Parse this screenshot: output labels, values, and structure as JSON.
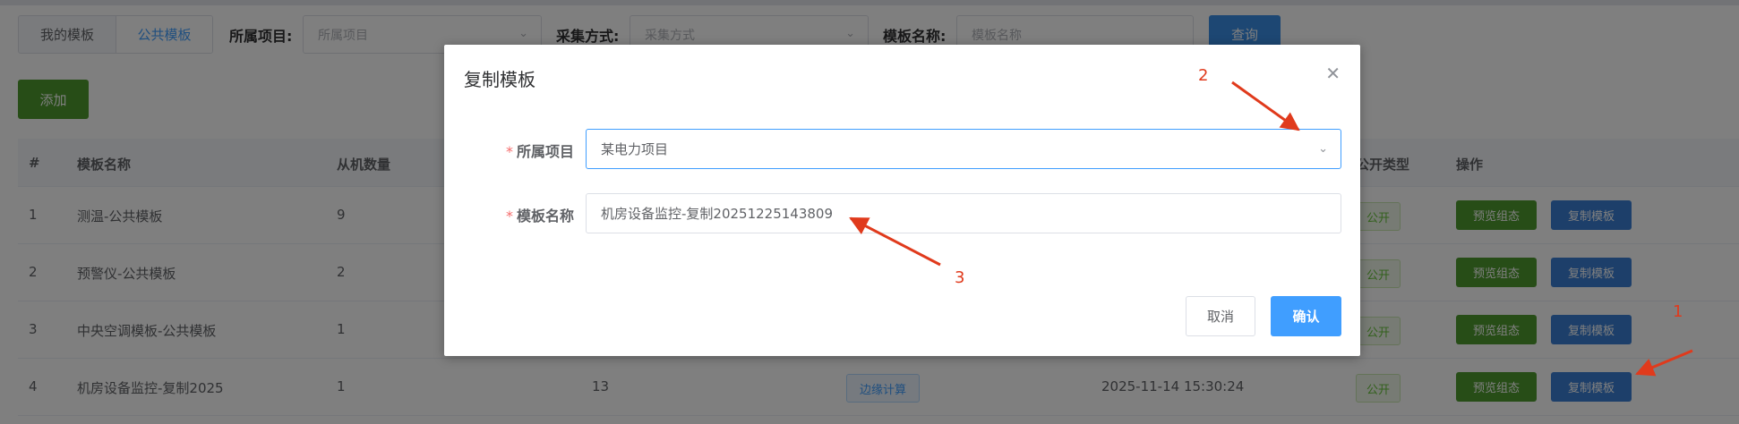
{
  "toolbar": {
    "tabs": [
      {
        "label": "我的模板",
        "active": false
      },
      {
        "label": "公共模板",
        "active": true
      }
    ],
    "project_label": "所属项目:",
    "project_placeholder": "所属项目",
    "collect_label": "采集方式:",
    "collect_placeholder": "采集方式",
    "name_label": "模板名称:",
    "name_placeholder": "模板名称",
    "query_label": "查询",
    "add_label": "添加"
  },
  "table": {
    "headers": {
      "index": "#",
      "name": "模板名称",
      "slave_count": "从机数量",
      "public_type": "公开类型",
      "actions": "操作"
    },
    "rows": [
      {
        "index": "1",
        "name": "测温-公共模板",
        "slave_count": "9",
        "col4": "",
        "col5": "",
        "col6": "",
        "public_tag": "公开",
        "btn_preview": "预览组态",
        "btn_copy": "复制模板"
      },
      {
        "index": "2",
        "name": "预警仪-公共模板",
        "slave_count": "2",
        "col4": "",
        "col5": "",
        "col6": "",
        "public_tag": "公开",
        "btn_preview": "预览组态",
        "btn_copy": "复制模板"
      },
      {
        "index": "3",
        "name": "中央空调模板-公共模板",
        "slave_count": "1",
        "col4": "",
        "col5": "",
        "col6": "",
        "public_tag": "公开",
        "btn_preview": "预览组态",
        "btn_copy": "复制模板"
      },
      {
        "index": "4",
        "name": "机房设备监控-复制2025",
        "slave_count": "1",
        "col4": "13",
        "col5": "边缘计算",
        "col6": "2025-11-14 15:30:24",
        "public_tag": "公开",
        "btn_preview": "预览组态",
        "btn_copy": "复制模板"
      }
    ]
  },
  "dialog": {
    "title": "复制模板",
    "project_label": "所属项目",
    "project_value": "某电力项目",
    "name_label": "模板名称",
    "name_value": "机房设备监控-复制20251225143809",
    "required_mark": "*",
    "cancel_label": "取消",
    "confirm_label": "确认"
  },
  "annotations": {
    "one": "1",
    "two": "2",
    "three": "3",
    "color": "#e03a1c"
  },
  "colors": {
    "primary": "#409eff",
    "success": "#4e9b2f",
    "danger": "#f56c6c"
  }
}
